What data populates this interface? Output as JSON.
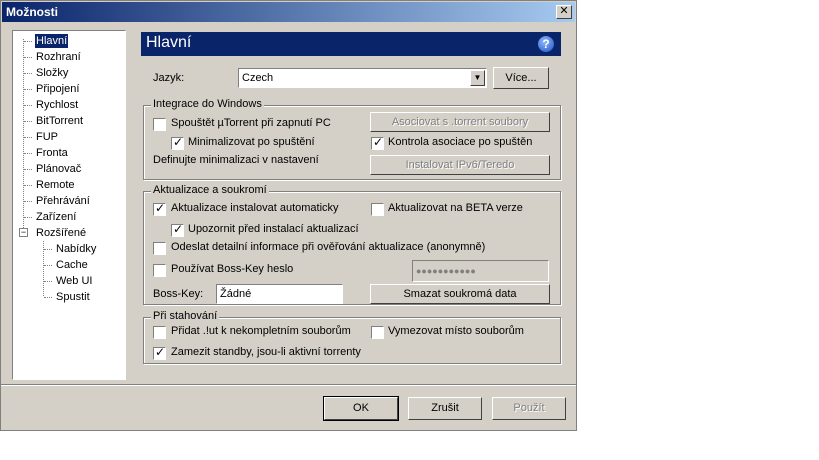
{
  "window": {
    "title": "Možnosti",
    "close_glyph": "✕"
  },
  "tree": {
    "items": [
      {
        "label": "Hlavní"
      },
      {
        "label": "Rozhraní"
      },
      {
        "label": "Složky"
      },
      {
        "label": "Připojení"
      },
      {
        "label": "Rychlost"
      },
      {
        "label": "BitTorrent"
      },
      {
        "label": "FUP"
      },
      {
        "label": "Fronta"
      },
      {
        "label": "Plánovač"
      },
      {
        "label": "Remote"
      },
      {
        "label": "Přehrávání"
      },
      {
        "label": "Zařízení"
      },
      {
        "label": "Rozšířené"
      },
      {
        "label": "Nabídky"
      },
      {
        "label": "Cache"
      },
      {
        "label": "Web UI"
      },
      {
        "label": "Spustit"
      }
    ],
    "expander_glyph": "−"
  },
  "header": {
    "title": "Hlavní",
    "help_glyph": "?"
  },
  "language": {
    "label": "Jazyk:",
    "value": "Czech",
    "more_button": "Více..."
  },
  "windows_integration": {
    "title": "Integrace do Windows",
    "start_with_pc": "Spouštět µTorrent při zapnutí PC",
    "minimize_on_start": "Minimalizovat po spuštění",
    "define_minimize": "Definujte minimalizaci v nastavení",
    "associate_button": "Asociovat s .torrent soubory",
    "check_association": "Kontrola asociace po spuštěn",
    "install_ipv6_button": "Instalovat IPv6/Teredo"
  },
  "updates_privacy": {
    "title": "Aktualizace a soukromí",
    "auto_update": "Aktualizace instalovat automaticky",
    "beta_update": "Aktualizovat na BETA verze",
    "notify_before": "Upozornit před instalací aktualizací",
    "send_info": "Odeslat detailní informace při ověřování aktualizace (anonymně)",
    "boss_key_password": "Používat Boss-Key heslo",
    "password_mask": "●●●●●●●●●●●",
    "boss_key_label": "Boss-Key:",
    "boss_key_value": "Žádné",
    "clear_private_button": "Smazat soukromá data"
  },
  "downloading": {
    "title": "Při stahování",
    "append_ut": "Přidat .!ut k nekompletním souborům",
    "preallocate": "Vymezovat místo souborům",
    "prevent_standby": "Zamezit standby, jsou-li aktivní torrenty"
  },
  "footer": {
    "ok": "OK",
    "cancel": "Zrušit",
    "apply": "Použít"
  }
}
